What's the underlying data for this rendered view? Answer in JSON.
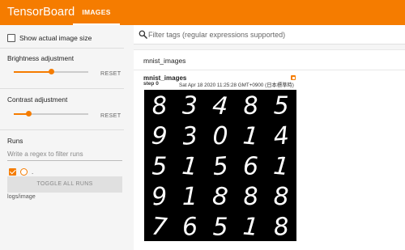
{
  "header": {
    "brand": "TensorBoard",
    "tabs": [
      {
        "label": "IMAGES",
        "active": true
      }
    ]
  },
  "sidebar": {
    "show_actual_size_label": "Show actual image size",
    "brightness": {
      "label": "Brightness adjustment",
      "reset_label": "RESET",
      "value_fraction": 0.5
    },
    "contrast": {
      "label": "Contrast adjustment",
      "reset_label": "RESET",
      "value_fraction": 0.2
    },
    "runs": {
      "label": "Runs",
      "regex_placeholder": "Write a regex to filter runs",
      "items": [
        {
          "name": ".",
          "checked": true
        }
      ],
      "toggle_all_label": "TOGGLE ALL RUNS",
      "path": "logs/image"
    }
  },
  "main": {
    "filter_placeholder": "Filter tags (regular expressions supported)",
    "category": "mnist_images",
    "card": {
      "tag": "mnist_images",
      "step_label": "step",
      "step": "0",
      "timestamp": "Sat Apr 18 2020 11:25:28 GMT+0900 (日本標準時)"
    },
    "digits": [
      [
        "8",
        "3",
        "4",
        "8",
        "5"
      ],
      [
        "9",
        "3",
        "0",
        "1",
        "4"
      ],
      [
        "5",
        "1",
        "5",
        "6",
        "1"
      ],
      [
        "9",
        "1",
        "8",
        "8",
        "8"
      ],
      [
        "7",
        "6",
        "5",
        "1",
        "8"
      ]
    ]
  },
  "colors": {
    "accent": "#f57c00",
    "background": "#f5f5f5"
  }
}
